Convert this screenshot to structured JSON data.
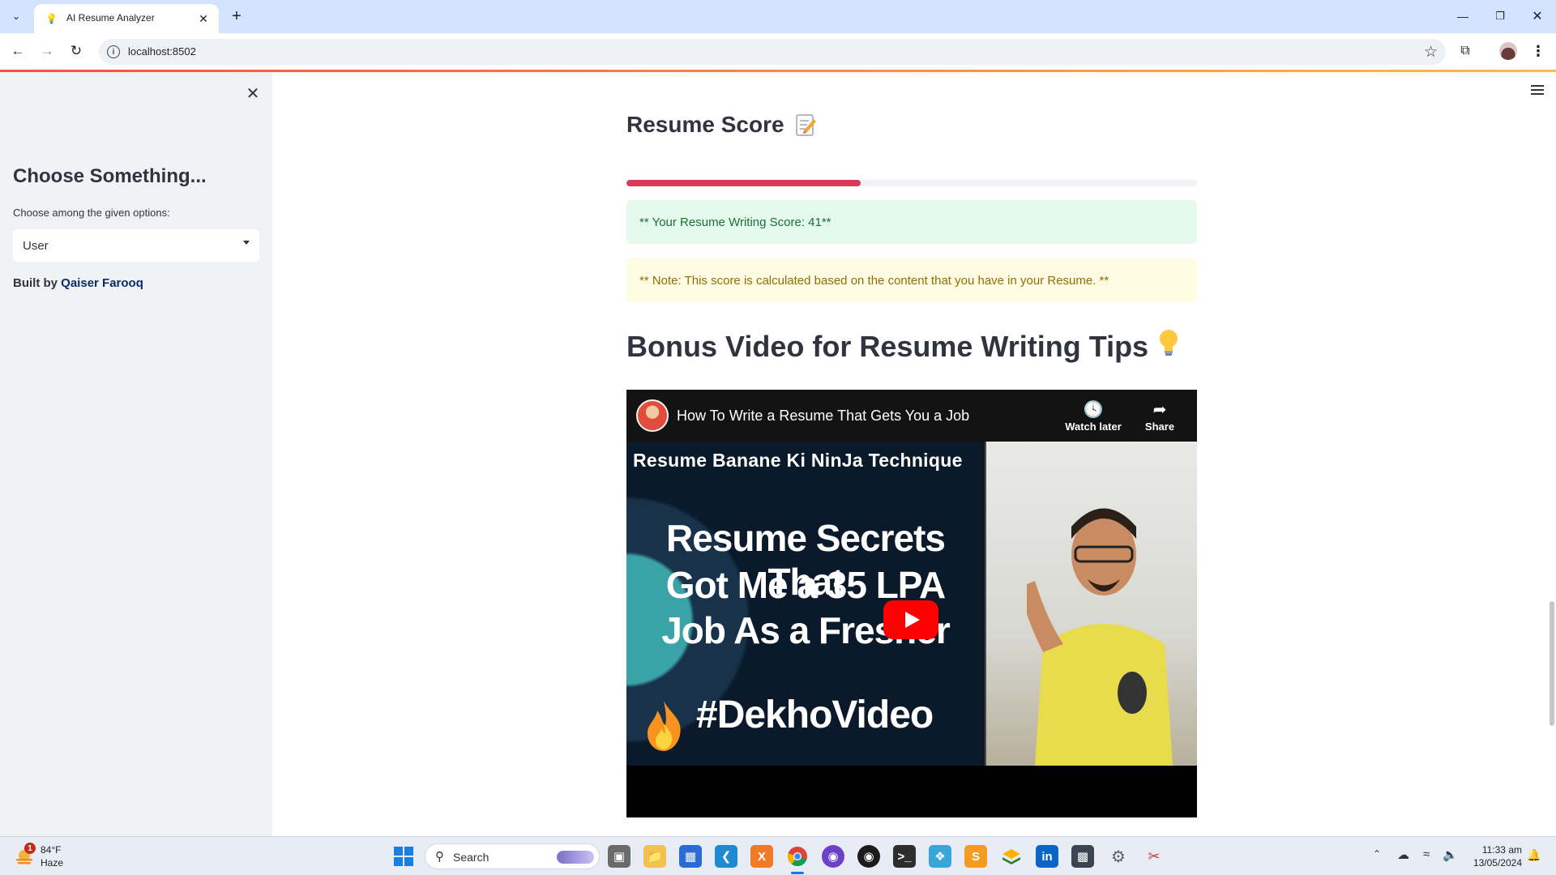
{
  "browser": {
    "tab_title": "AI Resume Analyzer",
    "url": "localhost:8502"
  },
  "sidebar": {
    "heading": "Choose Something...",
    "select_label": "Choose among the given options:",
    "select_value": "User",
    "built_by_prefix": "Built by ",
    "built_by_name": "Qaiser Farooq"
  },
  "main": {
    "score_heading": "Resume Score",
    "score_progress_percent": 41,
    "success_message": "** Your Resume Writing Score: 41**",
    "note_message": "** Note: This score is calculated based on the content that you have in your Resume. **",
    "bonus_heading": "Bonus Video for Resume Writing Tips",
    "bonus_icon": "lightbulb-icon"
  },
  "video": {
    "title": "How To Write a Resume That Gets You a Job",
    "watch_later_label": "Watch later",
    "share_label": "Share",
    "thumbnail": {
      "banner": "Resume Banane Ki NinJa Technique",
      "line1": "Resume Secrets That",
      "line2": "Got Me a 35 LPA",
      "line3": "Job As a Fresher",
      "hashtag": "#DekhoVideo"
    }
  },
  "taskbar": {
    "weather_temp": "84°F",
    "weather_condition": "Haze",
    "weather_badge": "1",
    "search_placeholder": "Search",
    "time": "11:33 am",
    "date": "13/05/2024"
  },
  "colors": {
    "progress_fill": "#d83a5a",
    "success_bg": "#e6f9ed",
    "warning_bg": "#fffce4",
    "sidebar_bg": "#f0f2f6",
    "browser_tabbar": "#d3e3fd"
  }
}
